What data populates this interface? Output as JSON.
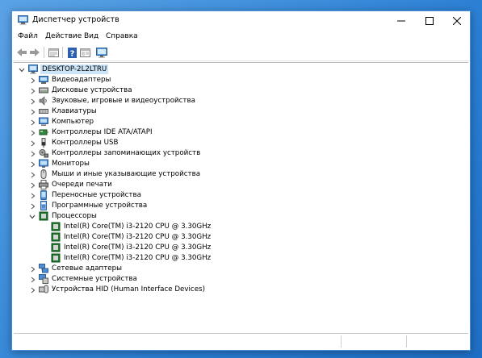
{
  "window": {
    "title": "Диспетчер устройств",
    "caption_minimize": "—",
    "caption_maximize": "☐",
    "caption_close": "✕"
  },
  "menu": [
    "Файл",
    "Действие",
    "Вид",
    "Справка"
  ],
  "toolbar": {
    "buttons": [
      "back-icon",
      "forward-icon",
      "properties-icon",
      "help-icon",
      "view-icon",
      "monitor-scan-icon"
    ]
  },
  "tree": {
    "root": "DESKTOP-2L2LTRU",
    "categories": [
      {
        "label": "Видеоадаптеры",
        "icon": "display-adapter-icon",
        "expanded": false
      },
      {
        "label": "Дисковые устройства",
        "icon": "disk-drive-icon",
        "expanded": false
      },
      {
        "label": "Звуковые, игровые и видеоустройства",
        "icon": "sound-icon",
        "expanded": false
      },
      {
        "label": "Клавиатуры",
        "icon": "keyboard-icon",
        "expanded": false
      },
      {
        "label": "Компьютер",
        "icon": "computer-icon",
        "expanded": false
      },
      {
        "label": "Контроллеры IDE ATA/ATAPI",
        "icon": "ide-controller-icon",
        "expanded": false
      },
      {
        "label": "Контроллеры USB",
        "icon": "usb-icon",
        "expanded": false
      },
      {
        "label": "Контроллеры запоминающих устройств",
        "icon": "storage-controller-icon",
        "expanded": false
      },
      {
        "label": "Мониторы",
        "icon": "monitor-icon",
        "expanded": false
      },
      {
        "label": "Мыши и иные указывающие устройства",
        "icon": "mouse-icon",
        "expanded": false
      },
      {
        "label": "Очереди печати",
        "icon": "printer-icon",
        "expanded": false
      },
      {
        "label": "Переносные устройства",
        "icon": "portable-device-icon",
        "expanded": false
      },
      {
        "label": "Программные устройства",
        "icon": "software-device-icon",
        "expanded": false
      },
      {
        "label": "Процессоры",
        "icon": "processor-icon",
        "expanded": true,
        "children": [
          "Intel(R) Core(TM) i3-2120 CPU @ 3.30GHz",
          "Intel(R) Core(TM) i3-2120 CPU @ 3.30GHz",
          "Intel(R) Core(TM) i3-2120 CPU @ 3.30GHz",
          "Intel(R) Core(TM) i3-2120 CPU @ 3.30GHz"
        ]
      },
      {
        "label": "Сетевые адаптеры",
        "icon": "network-adapter-icon",
        "expanded": false
      },
      {
        "label": "Системные устройства",
        "icon": "system-device-icon",
        "expanded": false
      },
      {
        "label": "Устройства HID (Human Interface Devices)",
        "icon": "hid-icon",
        "expanded": false
      }
    ]
  },
  "colors": {
    "selection": "#cce4f7",
    "window_border": "#4a8fd6",
    "desktop": "#2a7fd4"
  }
}
